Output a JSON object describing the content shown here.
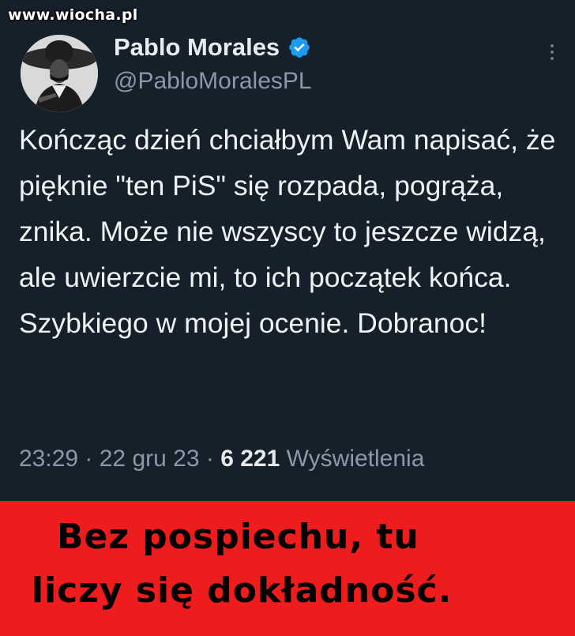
{
  "watermark": "www.wiocha.pl",
  "tweet": {
    "author_name": "Pablo Morales",
    "author_handle": "@PabloMoralesPL",
    "text": "Kończąc dzień chciałbym Wam napisać, że pięknie \"ten PiS\" się rozpada, pogrąża, znika. Może nie wszyscy to jeszcze widzą, ale uwierzcie mi, to ich początek końca. Szybkiego w mojej ocenie. Dobranoc!",
    "time": "23:29",
    "separator1": " · ",
    "date": "22 gru 23",
    "separator2": " · ",
    "views_count": "6 221",
    "views_label": " Wyświetlenia",
    "icons": [
      "avatar",
      "verified-badge-icon",
      "more-options-icon"
    ],
    "colors": {
      "background": "#15202b",
      "verified": "#1d9bf0",
      "secondary_text": "#8b98a5"
    }
  },
  "caption": {
    "line1": "Bez pospiechu, tu",
    "line2": "liczy się dokładność.",
    "background": "#ee1c1c"
  }
}
